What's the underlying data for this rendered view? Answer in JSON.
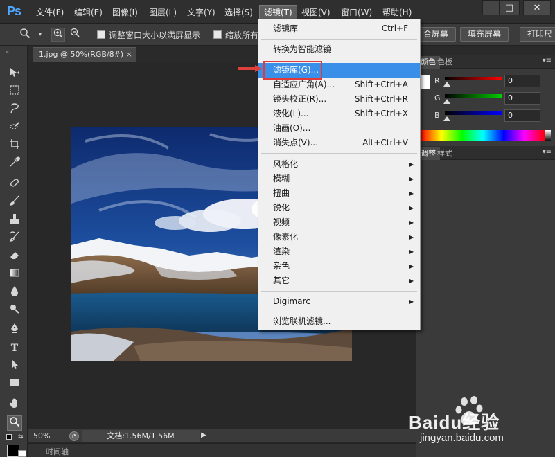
{
  "menubar": {
    "logo": "Ps",
    "items": [
      "文件(F)",
      "编辑(E)",
      "图像(I)",
      "图层(L)",
      "文字(Y)",
      "选择(S)",
      "滤镜(T)",
      "视图(V)",
      "窗口(W)",
      "帮助(H)"
    ],
    "active_index": 6
  },
  "window_controls": {
    "minimize": "—",
    "maximize": "□",
    "close": "✕"
  },
  "options_bar": {
    "resize_windows_label": "调整窗口大小以满屏显示",
    "zoom_all_label": "缩放所有",
    "fit_screen_label": "合屏幕",
    "fill_screen_label": "填充屏幕",
    "print_size_label": "打印尺"
  },
  "document_tab": {
    "title": "1.jpg @ 50%(RGB/8#)",
    "close": "×"
  },
  "status_bar": {
    "zoom": "50%",
    "doc_info": "文档:1.56M/1.56M"
  },
  "timeline": {
    "label": "时间轴"
  },
  "color_panel": {
    "tabs": [
      "颜色",
      "色板"
    ],
    "channels": [
      {
        "label": "R",
        "value": "0",
        "color": "#ff0000"
      },
      {
        "label": "G",
        "value": "0",
        "color": "#00cc00"
      },
      {
        "label": "B",
        "value": "0",
        "color": "#0000ff"
      }
    ]
  },
  "adjust_panel": {
    "tabs": [
      "调整",
      "样式"
    ]
  },
  "filter_menu": {
    "top_items": [
      {
        "label": "滤镜库",
        "shortcut": "Ctrl+F"
      }
    ],
    "smart_items": [
      {
        "label": "转换为智能滤镜",
        "shortcut": ""
      }
    ],
    "main_items": [
      {
        "label": "滤镜库(G)...",
        "shortcut": ""
      },
      {
        "label": "自适应广角(A)...",
        "shortcut": "Shift+Ctrl+A"
      },
      {
        "label": "镜头校正(R)...",
        "shortcut": "Shift+Ctrl+R"
      },
      {
        "label": "液化(L)...",
        "shortcut": "Shift+Ctrl+X"
      },
      {
        "label": "油画(O)...",
        "shortcut": ""
      },
      {
        "label": "消失点(V)...",
        "shortcut": "Alt+Ctrl+V"
      }
    ],
    "sub_menus": [
      "风格化",
      "模糊",
      "扭曲",
      "锐化",
      "视频",
      "像素化",
      "渲染",
      "杂色",
      "其它"
    ],
    "plugin_items": [
      "Digimarc"
    ],
    "browse_item": "浏览联机滤镜...",
    "highlighted": "滤镜库(G)..."
  },
  "watermark": {
    "brand": "Baidu经验",
    "url": "jingyan.baidu.com"
  }
}
